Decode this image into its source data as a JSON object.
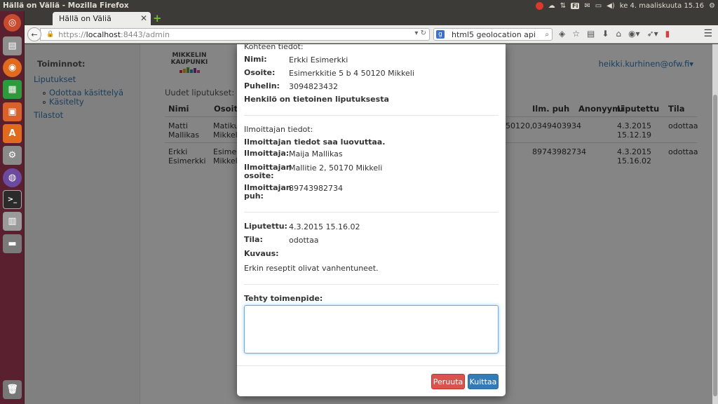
{
  "os": {
    "window_title": "Hällä on Väliä - Mozilla Firefox",
    "clock": "ke 4. maaliskuuta 15.16",
    "keyboard_layout": "Fi"
  },
  "browser": {
    "tab_title": "Hällä on Väliä",
    "url_scheme": "https://",
    "url_host": "localhost",
    "url_path": ":8443/admin",
    "search_query": "html5 geolocation api"
  },
  "sidebar": {
    "heading": "Toiminnot:",
    "items": [
      {
        "label": "Liputukset"
      },
      {
        "label": "Odottaa käsittelyä"
      },
      {
        "label": "Käsitelty"
      },
      {
        "label": "Tilastot"
      }
    ]
  },
  "header": {
    "logo_line1": "MIKKELIN",
    "logo_line2": "KAUPUNKI",
    "user": "heikki.kurhinen@ofw.fi"
  },
  "table": {
    "title": "Uudet liputukset:",
    "columns": [
      "Nimi",
      "Osoite",
      "Ilm. puh",
      "Anonyymi",
      "Liputettu",
      "Tila"
    ],
    "rows": [
      {
        "nimi": [
          "Matti",
          "Mallikas"
        ],
        "osoite": [
          "Matikun",
          "Mikkeli"
        ],
        "osoite_tail": "50120,",
        "ilm_puh": "0349403934",
        "liputettu": [
          "4.3.2015",
          "15.12.19"
        ],
        "tila": "odottaa"
      },
      {
        "nimi": [
          "Erkki",
          "Esimerkki"
        ],
        "osoite": [
          "Esimerk",
          "Mikkeli"
        ],
        "osoite_tail": "",
        "ilm_puh": "89743982734",
        "liputettu": [
          "4.3.2015",
          "15.16.02"
        ],
        "tila": "odottaa"
      }
    ]
  },
  "modal": {
    "target_heading": "Kohteen tiedot:",
    "nimi_label": "Nimi:",
    "nimi_value": "Erkki Esimerkki",
    "osoite_label": "Osoite:",
    "osoite_value": "Esimerkkitie 5 b 4 50120 Mikkeli",
    "puhelin_label": "Puhelin:",
    "puhelin_value": "3094823432",
    "aware_note": "Henkilö on tietoinen liputuksesta",
    "reporter_heading": "Ilmoittajan tiedot:",
    "reporter_note": "Ilmoittajan tiedot saa luovuttaa.",
    "reporter_label": "Ilmoittaja:",
    "reporter_value": "Maija Mallikas",
    "reporter_addr_label_1": "Ilmoittajan",
    "reporter_addr_label_2": "osoite:",
    "reporter_addr_value": "Mallitie 2, 50170 Mikkeli",
    "reporter_phone_label_1": "Ilmoittajan",
    "reporter_phone_label_2": "puh:",
    "reporter_phone_value": "89743982734",
    "liputettu_label": "Liputettu:",
    "liputettu_value": "4.3.2015 15.16.02",
    "tila_label": "Tila:",
    "tila_value": "odottaa",
    "kuvaus_label": "Kuvaus:",
    "kuvaus_value": "Erkin reseptit olivat vanhentuneet.",
    "action_label": "Tehty toimenpide:",
    "action_value": "",
    "cancel_button": "Peruuta",
    "confirm_button": "Kuittaa"
  },
  "colors": {
    "danger": "#d9534f",
    "primary": "#337ab7",
    "launcher": "#5b2030"
  }
}
